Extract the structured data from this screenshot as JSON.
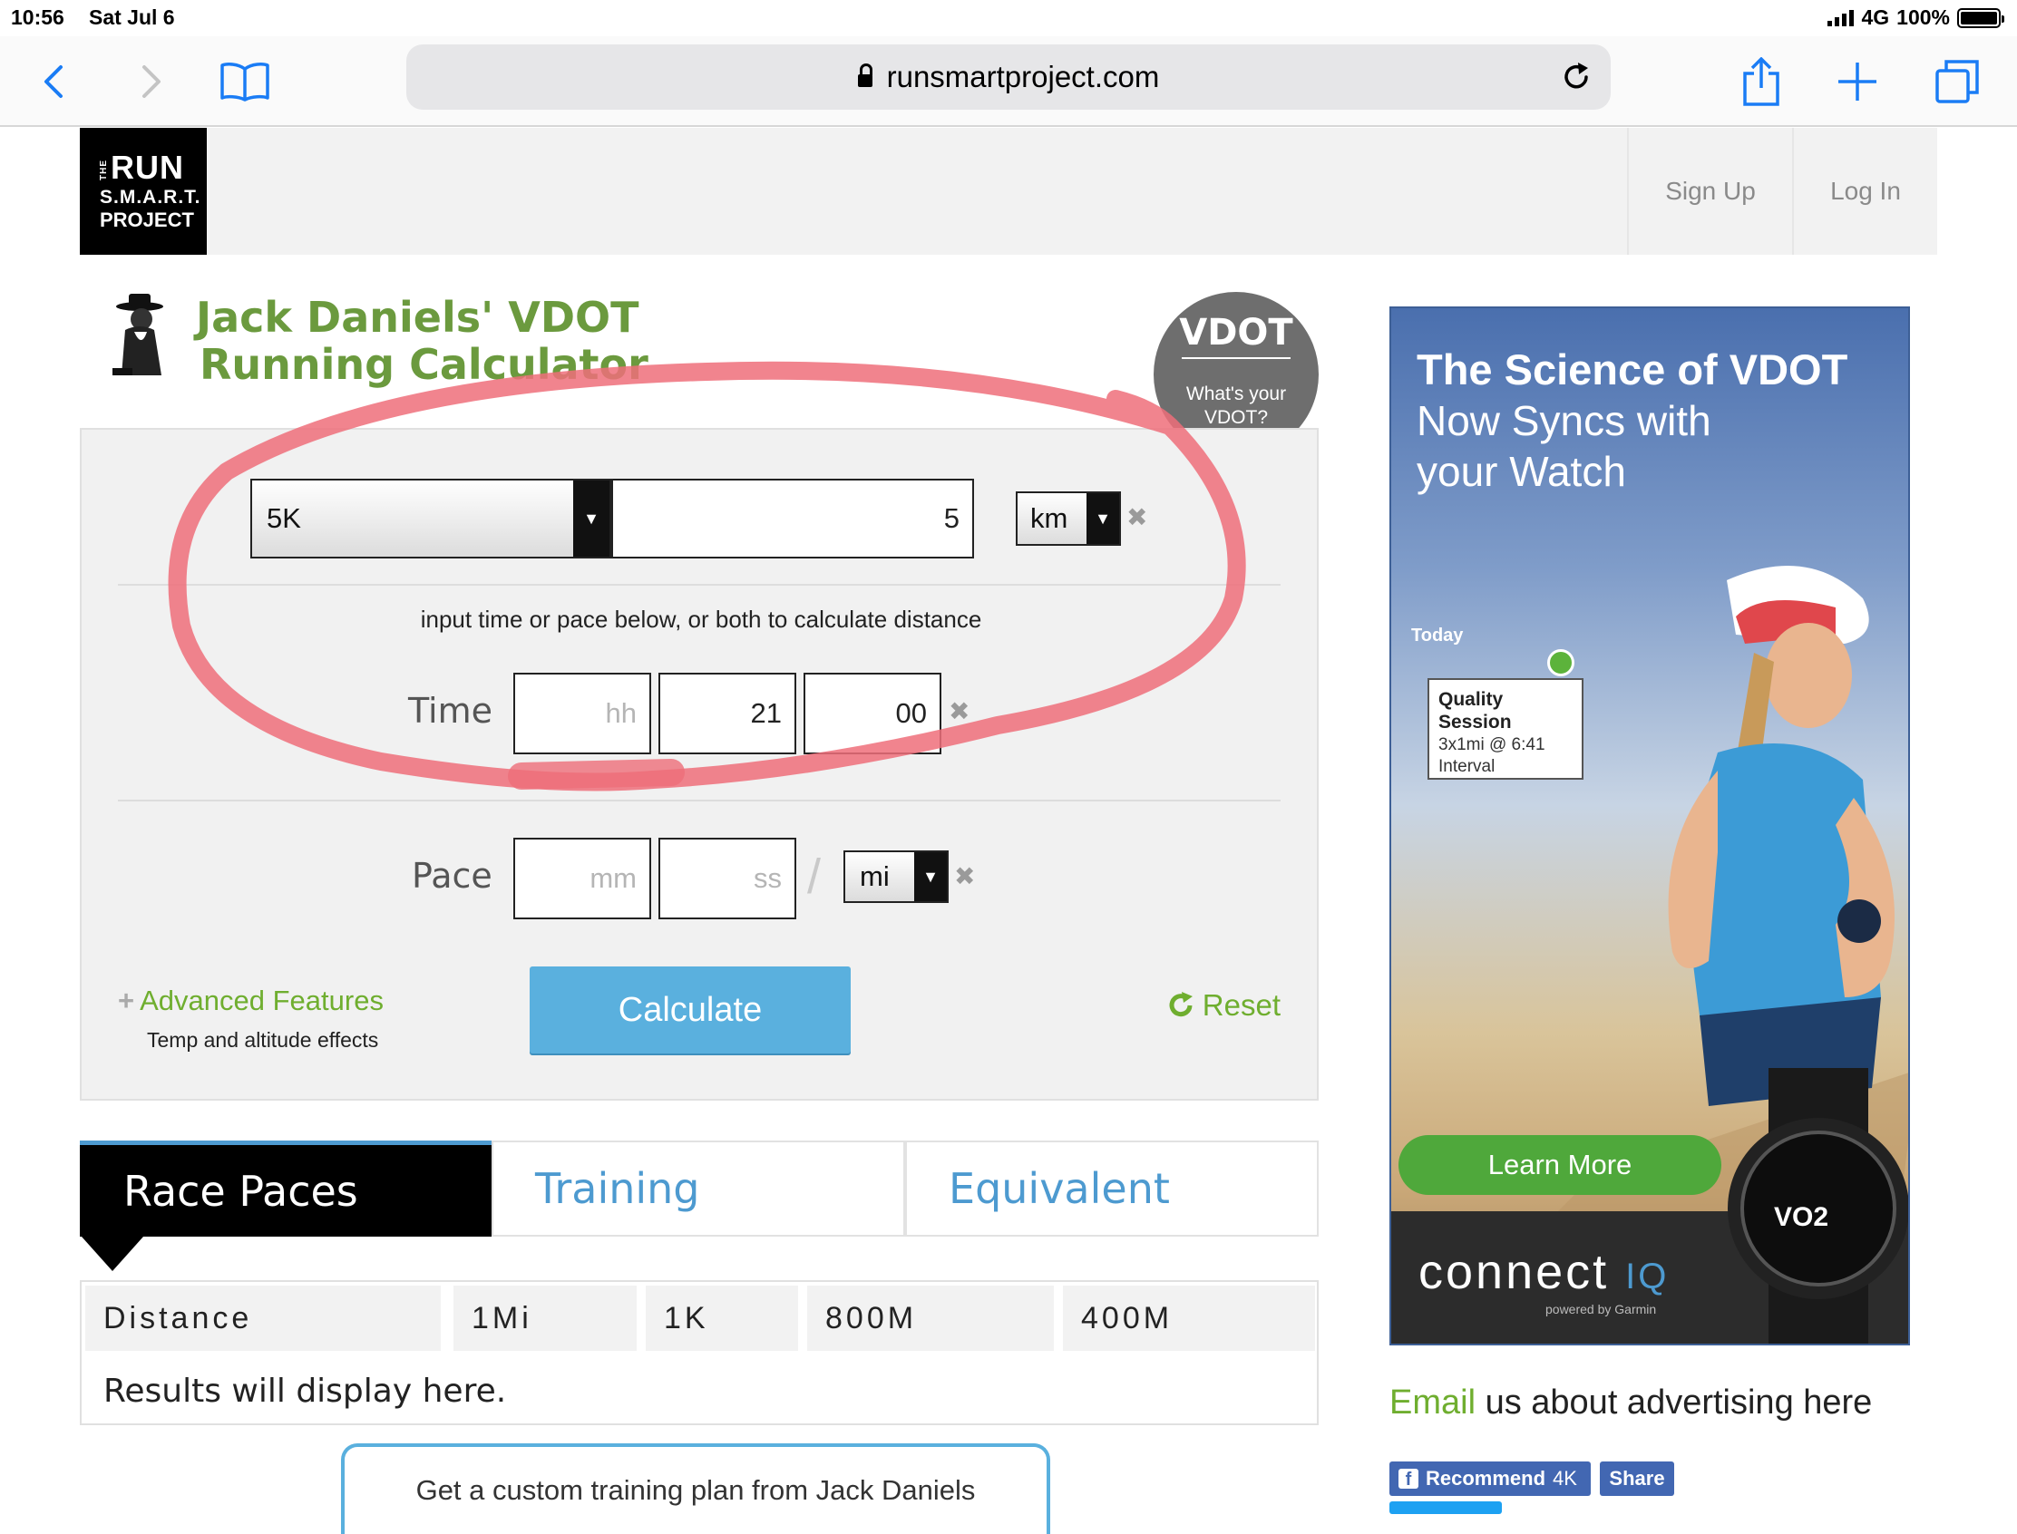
{
  "status_bar": {
    "time": "10:56",
    "date": "Sat Jul 6",
    "network": "4G",
    "battery": "100%"
  },
  "browser": {
    "url": "runsmartproject.com"
  },
  "site_header": {
    "logo_lines": [
      "RUN",
      "S.M.A.R.T.",
      "PROJECT"
    ],
    "logo_small": "THE",
    "sign_up": "Sign Up",
    "log_in": "Log In"
  },
  "title": {
    "line1": "Jack Daniels' VDOT",
    "line2": "Running Calculator"
  },
  "vdot_badge": {
    "title": "VDOT",
    "line1": "What's your",
    "line2": "VDOT?"
  },
  "calculator": {
    "race_select": "5K",
    "distance_value": "5",
    "distance_unit": "km",
    "hint": "input time or pace below, or both to calculate distance",
    "time_label": "Time",
    "time_hh_placeholder": "hh",
    "time_mm": "21",
    "time_ss": "00",
    "pace_label": "Pace",
    "pace_mm_placeholder": "mm",
    "pace_ss_placeholder": "ss",
    "pace_slash": "/",
    "pace_unit": "mi",
    "clear": "✖",
    "advanced": "Advanced Features",
    "advanced_sub": "Temp and altitude effects",
    "calculate": "Calculate",
    "reset": "Reset"
  },
  "tabs": [
    "Race Paces",
    "Training",
    "Equivalent"
  ],
  "results": {
    "columns": [
      "Distance",
      "1Mi",
      "1K",
      "800M",
      "400M"
    ],
    "message": "Results will display here."
  },
  "plan_button": "Get a custom training plan from Jack Daniels",
  "ad": {
    "title": "The Science of VDOT",
    "sub1": "Now Syncs with",
    "sub2": "your Watch",
    "today": "Today",
    "card_title": "Quality Session",
    "card_line1": "3x1mi @ 6:41",
    "card_line2": "Interval",
    "learn_more": "Learn More",
    "watch_text": "VO2",
    "brand": "connect",
    "brand_iq": "IQ",
    "powered": "powered by Garmin"
  },
  "email_ad": {
    "link": "Email",
    "rest": " us about advertising here"
  },
  "social": {
    "recommend": "Recommend",
    "count": "4K",
    "share": "Share"
  },
  "colors": {
    "title_green": "#6b9a3e",
    "link_green": "#6fae2f",
    "accent_blue": "#5ab0de",
    "annotation_red": "#ee6f7a"
  }
}
